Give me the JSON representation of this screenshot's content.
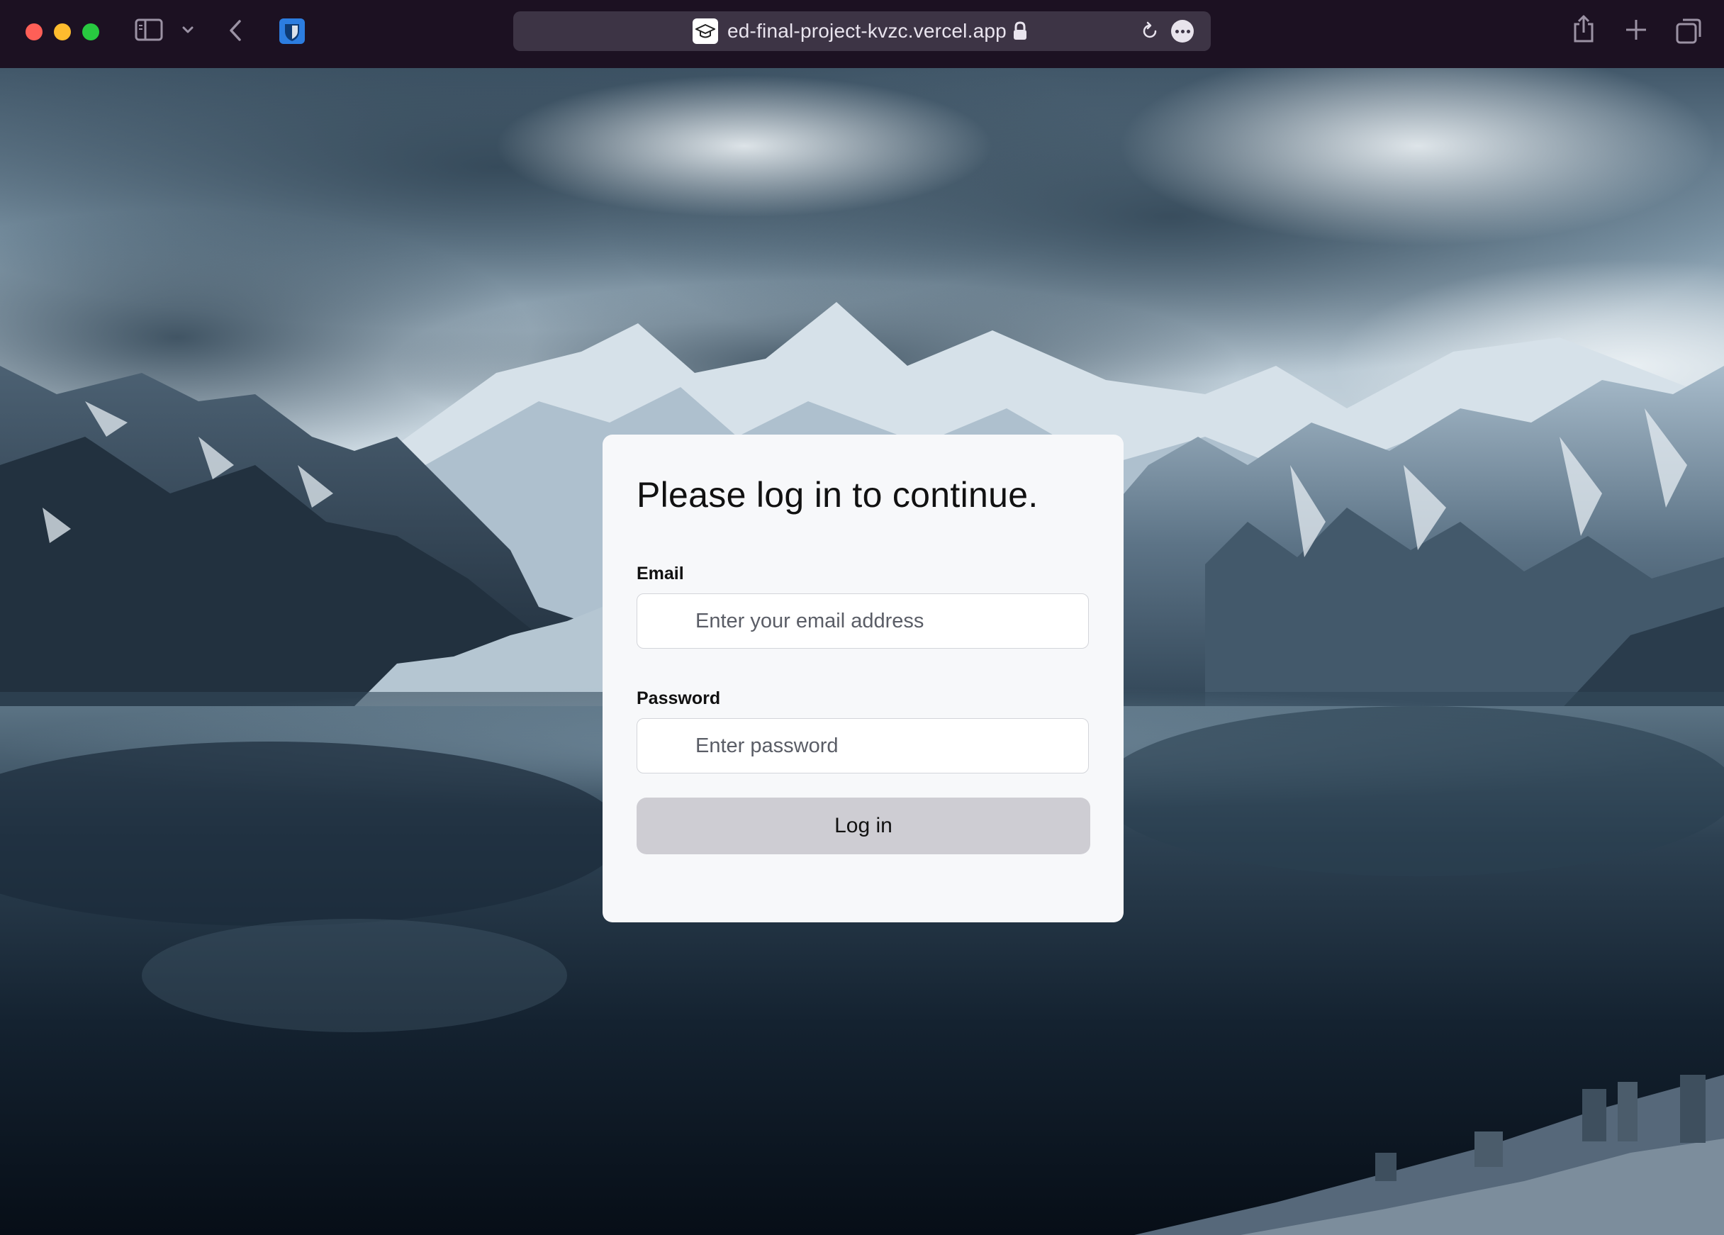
{
  "browser": {
    "url": "ed-final-project-kvzc.vercel.app",
    "icons": {
      "sidebar": "sidebar-icon",
      "dropdown": "chevron-down-icon",
      "back": "back-arrow-icon",
      "extension": "bitwarden-shield-icon",
      "favicon": "graduation-cap-icon",
      "lock": "lock-icon",
      "reload": "reload-icon",
      "more": "more-icon",
      "share": "share-icon",
      "new_tab": "plus-icon",
      "tabs": "tab-overview-icon"
    }
  },
  "login": {
    "title": "Please log in to continue.",
    "email_label": "Email",
    "email_placeholder": "Enter your email address",
    "email_value": "",
    "password_label": "Password",
    "password_placeholder": "Enter password",
    "password_value": "",
    "submit_label": "Log in"
  },
  "colors": {
    "chrome": "#1c1122",
    "urlbar": "#3d3445",
    "card": "#f7f8fa",
    "button": "#cecdd3",
    "accent_extension": "#2c7de0"
  }
}
